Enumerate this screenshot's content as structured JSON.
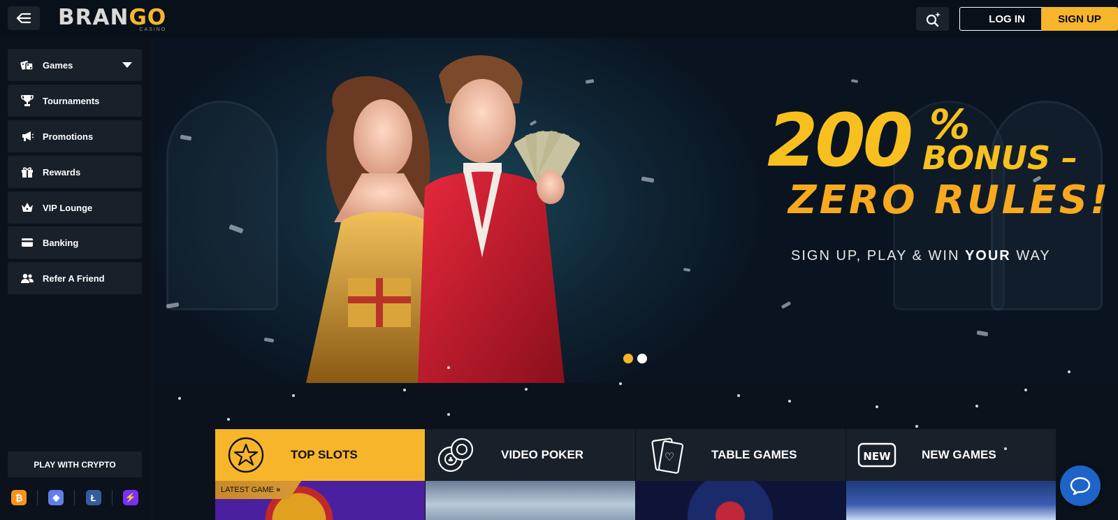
{
  "header": {
    "logo_main": "BRAN",
    "logo_accent": "GO",
    "logo_sub": "CASINO",
    "menu_icon": "menu-collapse-icon",
    "search_icon": "search-sparkle-icon",
    "login_label": "LOG IN",
    "signup_label": "SIGN UP",
    "accent_color": "#f7b52c"
  },
  "sidebar": {
    "items": [
      {
        "label": "Games",
        "icon": "dice-icon",
        "expandable": true
      },
      {
        "label": "Tournaments",
        "icon": "trophy-icon"
      },
      {
        "label": "Promotions",
        "icon": "megaphone-icon"
      },
      {
        "label": "Rewards",
        "icon": "gift-icon"
      },
      {
        "label": "VIP Lounge",
        "icon": "crown-icon"
      },
      {
        "label": "Banking",
        "icon": "credit-card-icon"
      },
      {
        "label": "Refer A Friend",
        "icon": "users-icon"
      }
    ],
    "crypto_label": "PLAY WITH CRYPTO",
    "crypto_icons": [
      {
        "name": "bitcoin-icon",
        "glyph": "₿",
        "color": "#f7931a"
      },
      {
        "name": "ethereum-icon",
        "glyph": "◆",
        "color": "#627eea"
      },
      {
        "name": "litecoin-icon",
        "glyph": "Ł",
        "color": "#345d9d"
      },
      {
        "name": "lightning-icon",
        "glyph": "⚡",
        "color": "#7b2ff7"
      }
    ]
  },
  "hero": {
    "big": "200",
    "pct": "%",
    "bonus": "BONUS –",
    "zero": "ZERO RULES!",
    "sub_pre": "SIGN UP, PLAY & WIN ",
    "sub_bold": "YOUR",
    "sub_post": " WAY",
    "slides": 2,
    "active_slide": 1,
    "dot_active_color": "#f7b52c",
    "dot_inactive_color": "#ffffff"
  },
  "categories": {
    "tabs": [
      {
        "label": "TOP SLOTS",
        "icon": "star-icon",
        "active": true
      },
      {
        "label": "VIDEO POKER",
        "icon": "poker-chips-icon",
        "active": false
      },
      {
        "label": "TABLE GAMES",
        "icon": "playing-cards-icon",
        "active": false
      },
      {
        "label": "NEW GAMES",
        "icon": "new-badge-icon",
        "active": false
      }
    ],
    "latest_badge": "LATEST GAME"
  },
  "chat": {
    "icon": "chat-bubble-icon"
  }
}
